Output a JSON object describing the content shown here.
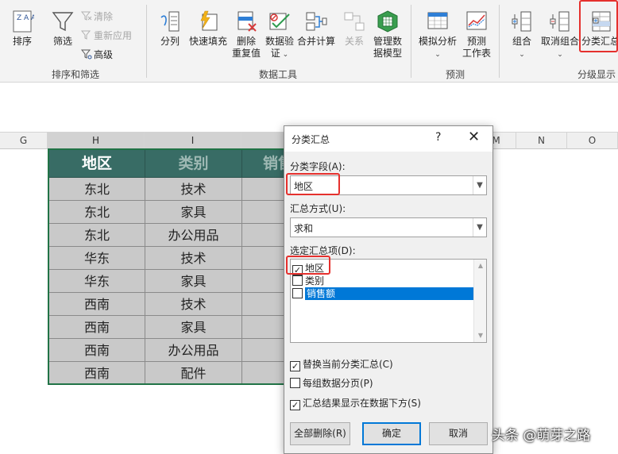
{
  "ribbon": {
    "sort_filter": {
      "sort_icon_text": "Z A A Z",
      "sort_label": "排序",
      "filter_label": "筛选",
      "clear_label": "清除",
      "reapply_label": "重新应用",
      "advanced_label": "高级",
      "group_label": "排序和筛选"
    },
    "data_tools": {
      "split_label": "分列",
      "flash_fill_label": "快速填充",
      "remove_dup_line1": "删除",
      "remove_dup_line2": "重复值",
      "validation_line1": "数据验",
      "validation_line2": "证",
      "consolidate_label": "合并计算",
      "relations_label": "关系",
      "data_model_line1": "管理数",
      "data_model_line2": "据模型",
      "group_label": "数据工具"
    },
    "forecast": {
      "whatif_label": "模拟分析",
      "forecast_sheet_line1": "预测",
      "forecast_sheet_line2": "工作表",
      "group_label": "预测"
    },
    "outline": {
      "group_btn_label": "组合",
      "ungroup_label": "取消组合",
      "subtotal_label": "分类汇总",
      "group_label": "分级显示"
    }
  },
  "sheet": {
    "columns": [
      "G",
      "H",
      "I",
      "",
      "",
      "",
      "",
      "M",
      "N",
      "O"
    ],
    "headers": [
      "地区",
      "类别",
      "销售额"
    ],
    "rows": [
      [
        "东北",
        "技术"
      ],
      [
        "东北",
        "家具"
      ],
      [
        "东北",
        "办公用品"
      ],
      [
        "华东",
        "技术"
      ],
      [
        "华东",
        "家具"
      ],
      [
        "西南",
        "技术"
      ],
      [
        "西南",
        "家具"
      ],
      [
        "西南",
        "办公用品"
      ],
      [
        "西南",
        "配件"
      ]
    ]
  },
  "dialog": {
    "title": "分类汇总",
    "help": "?",
    "close": "✕",
    "field_label": "分类字段(A):",
    "field_value": "地区",
    "func_label": "汇总方式(U):",
    "func_value": "求和",
    "items_label": "选定汇总项(D):",
    "items": [
      {
        "label": "地区",
        "checked": "✓"
      },
      {
        "label": "类别",
        "checked": ""
      },
      {
        "label": "销售额",
        "checked": ""
      }
    ],
    "opt_replace": "替换当前分类汇总(C)",
    "opt_pagebreak": "每组数据分页(P)",
    "opt_below": "汇总结果显示在数据下方(S)",
    "opt_replace_check": "✓",
    "opt_pagebreak_check": "",
    "opt_below_check": "✓",
    "btn_remove_all": "全部删除(R)",
    "btn_ok": "确定",
    "btn_cancel": "取消"
  },
  "watermark": "头条 @萌芽之路",
  "colors": {
    "header_fill": "#386c65",
    "cell_fill": "#c9c9c9",
    "highlight": "#e5302d",
    "selection": "#0078d7"
  }
}
